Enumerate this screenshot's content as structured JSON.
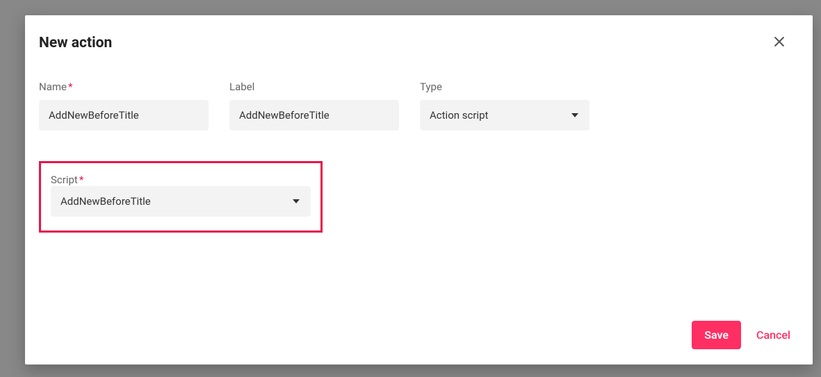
{
  "modal": {
    "title": "New action",
    "fields": {
      "name": {
        "label": "Name",
        "required": true,
        "value": "AddNewBeforeTitle"
      },
      "label": {
        "label": "Label",
        "required": false,
        "value": "AddNewBeforeTitle"
      },
      "type": {
        "label": "Type",
        "required": false,
        "value": "Action script"
      },
      "script": {
        "label": "Script",
        "required": true,
        "value": "AddNewBeforeTitle"
      }
    },
    "buttons": {
      "save": "Save",
      "cancel": "Cancel"
    }
  }
}
